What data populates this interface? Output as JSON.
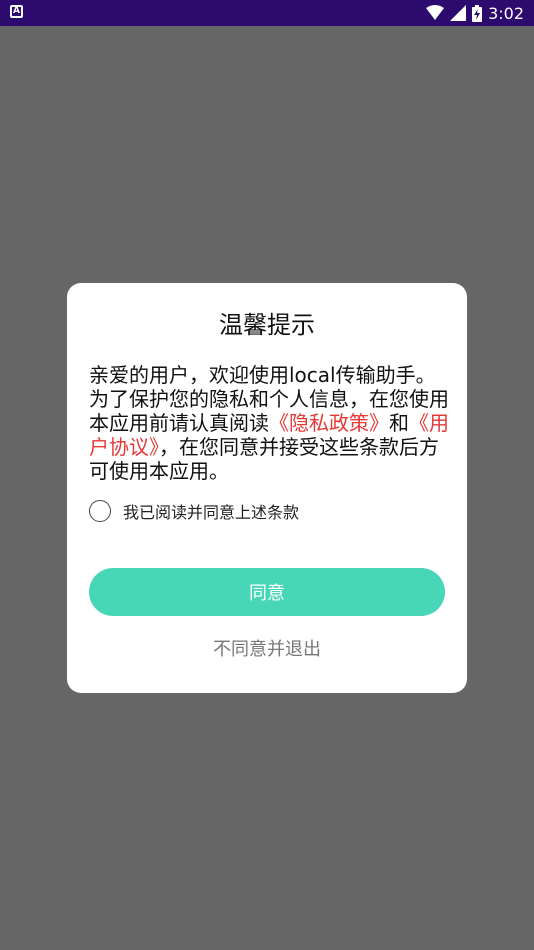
{
  "status_bar": {
    "time": "3:02",
    "left_icon": "A",
    "icons": [
      "wifi-icon",
      "signal-icon",
      "battery-charging-icon"
    ]
  },
  "dialog": {
    "title": "温馨提示",
    "body_part1": "亲爱的用户，欢迎使用local传输助手。为了保护您的隐私和个人信息，在您使用本应用前请认真阅读",
    "privacy_link": "《隐私政策》",
    "and_text": "和",
    "agreement_link": "《用户协议》",
    "body_part2": "，在您同意并接受这些条款后方可使用本应用。",
    "checkbox_label": "我已阅读并同意上述条款",
    "agree_button": "同意",
    "disagree_button": "不同意并退出"
  },
  "colors": {
    "status_bar": "#2d0a6e",
    "overlay": "#666666",
    "accent": "#47d7b6",
    "link": "#e53935"
  }
}
